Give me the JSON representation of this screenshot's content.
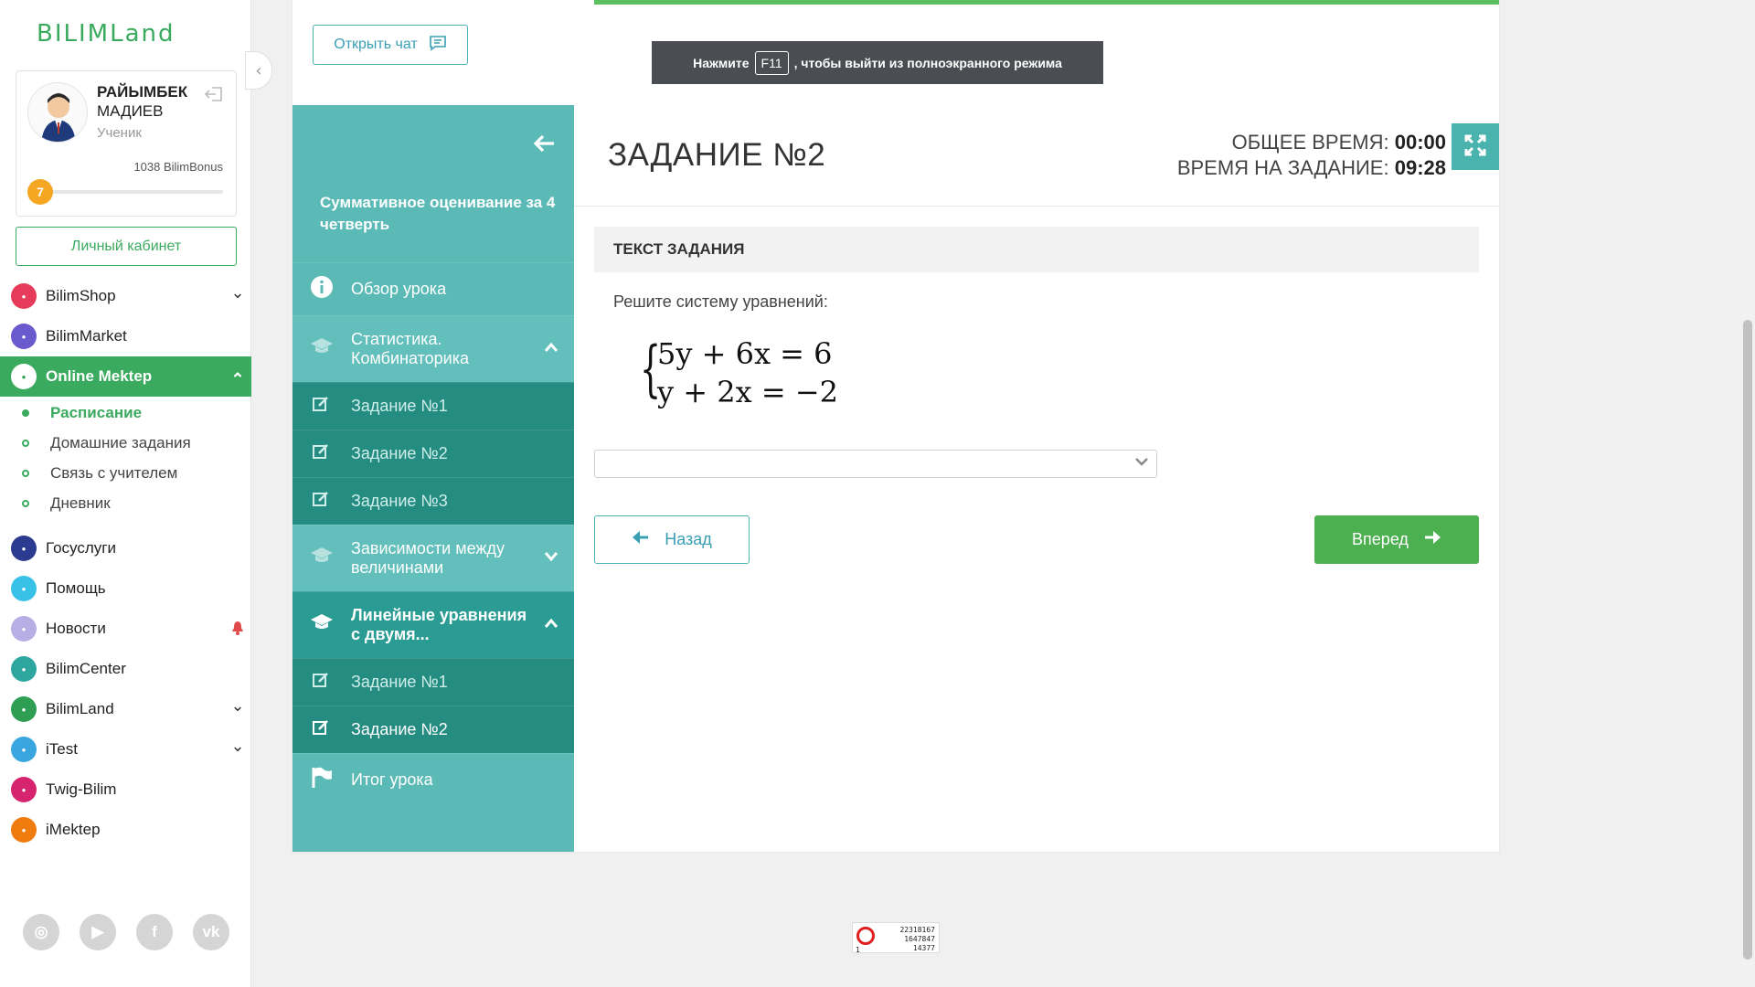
{
  "sidebar": {
    "logo": "BILIMLand",
    "profile": {
      "first_name": "РАЙЫМБЕК",
      "last_name": "МАДИЕВ",
      "role": "Ученик",
      "bonus": "1038 BilimBonus",
      "level": "7",
      "level_progress": 0.05
    },
    "cabinet_button": "Личный кабинет",
    "nav": [
      {
        "label": "BilimShop",
        "icon": "bilimshop-icon",
        "color": "#e63b5b",
        "caret": "down"
      },
      {
        "label": "BilimMarket",
        "icon": "bilimmarket-icon",
        "color": "#6a5acd",
        "caret": ""
      },
      {
        "label": "Online Mektep",
        "icon": "online-mektep-icon",
        "color": "#2e9e52",
        "caret": "up",
        "active": true
      },
      {
        "label": "Госуслуги",
        "icon": "gosuslugi-icon",
        "color": "#2b3b8f",
        "caret": ""
      },
      {
        "label": "Помощь",
        "icon": "help-icon",
        "color": "#39c2e8",
        "caret": ""
      },
      {
        "label": "Новости",
        "icon": "news-icon",
        "color": "#b7aee6",
        "caret": "bell"
      },
      {
        "label": "BilimCenter",
        "icon": "bilimcenter-icon",
        "color": "#2ea6a0",
        "caret": ""
      },
      {
        "label": "BilimLand",
        "icon": "bilimland-icon",
        "color": "#2e9e52",
        "caret": "down"
      },
      {
        "label": "iTest",
        "icon": "itest-icon",
        "color": "#3aa6e0",
        "caret": "down"
      },
      {
        "label": "Twig-Bilim",
        "icon": "twig-bilim-icon",
        "color": "#d6246e",
        "caret": ""
      },
      {
        "label": "iMektep",
        "icon": "imektep-icon",
        "color": "#f07b0f",
        "caret": ""
      }
    ],
    "subnav": [
      "Расписание",
      "Домашние задания",
      "Связь с учителем",
      "Дневник"
    ],
    "socials": [
      "instagram-icon",
      "youtube-icon",
      "facebook-icon",
      "vk-icon"
    ]
  },
  "header": {
    "chat_button": "Открыть чат",
    "fullscreen_hint_pre": "Нажмите",
    "fullscreen_key": "F11",
    "fullscreen_hint_post": ", чтобы выйти из полноэкранного режима"
  },
  "lesson_nav": {
    "title": "Суммативное оценивание за 4 четверть",
    "overview": "Обзор урока",
    "sections": [
      {
        "title": "Статистика. Комбинаторика",
        "expanded": true,
        "tasks": [
          "Задание №1",
          "Задание №2",
          "Задание №3"
        ]
      },
      {
        "title": "Зависимости между величинами",
        "expanded": false,
        "tasks": []
      },
      {
        "title": "Линейные уравнения с двумя...",
        "expanded": true,
        "tasks": [
          "Задание №1",
          "Задание №2"
        ]
      }
    ],
    "summary": "Итог урока"
  },
  "task": {
    "title": "ЗАДАНИЕ №2",
    "total_time_label": "ОБЩЕЕ ВРЕМЯ:",
    "total_time": "00:00",
    "task_time_label": "ВРЕМЯ НА ЗАДАНИЕ:",
    "task_time": "09:28",
    "section_header": "ТЕКСТ ЗАДАНИЯ",
    "prompt": "Решите систему уравнений:",
    "equations": [
      "5y + 6x = 6",
      "y + 2x = −2"
    ],
    "answer_value": "",
    "back_button": "Назад",
    "next_button": "Вперед"
  },
  "counter": {
    "line1": "22318167",
    "line2": "1647847",
    "line3": "14377",
    "line4": "1"
  },
  "colors": {
    "brand_green": "#3aaa5e",
    "teal": "#5bbab6",
    "teal_dark": "#258c82",
    "next_green": "#4caf50"
  }
}
